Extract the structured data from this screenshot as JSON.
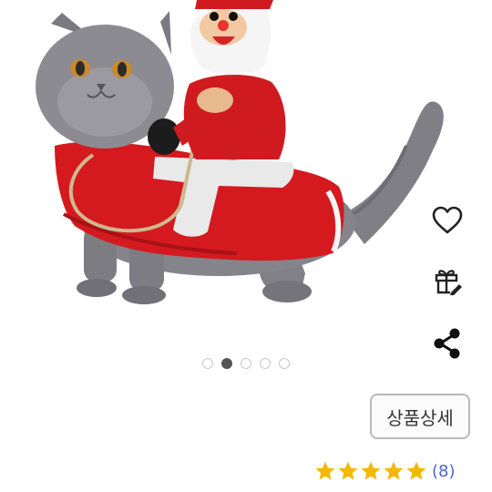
{
  "product": {
    "image_icon": "cat-santa-costume-photo"
  },
  "actions": {
    "wishlist_icon": "heart-icon",
    "gift_icon": "gift-icon",
    "share_icon": "share-icon"
  },
  "carousel": {
    "total": 5,
    "active_index": 1
  },
  "detail_button": {
    "label": "상품상세"
  },
  "rating": {
    "stars": 5,
    "max": 5,
    "star_color": "#f5b800",
    "review_count": "(8)"
  }
}
